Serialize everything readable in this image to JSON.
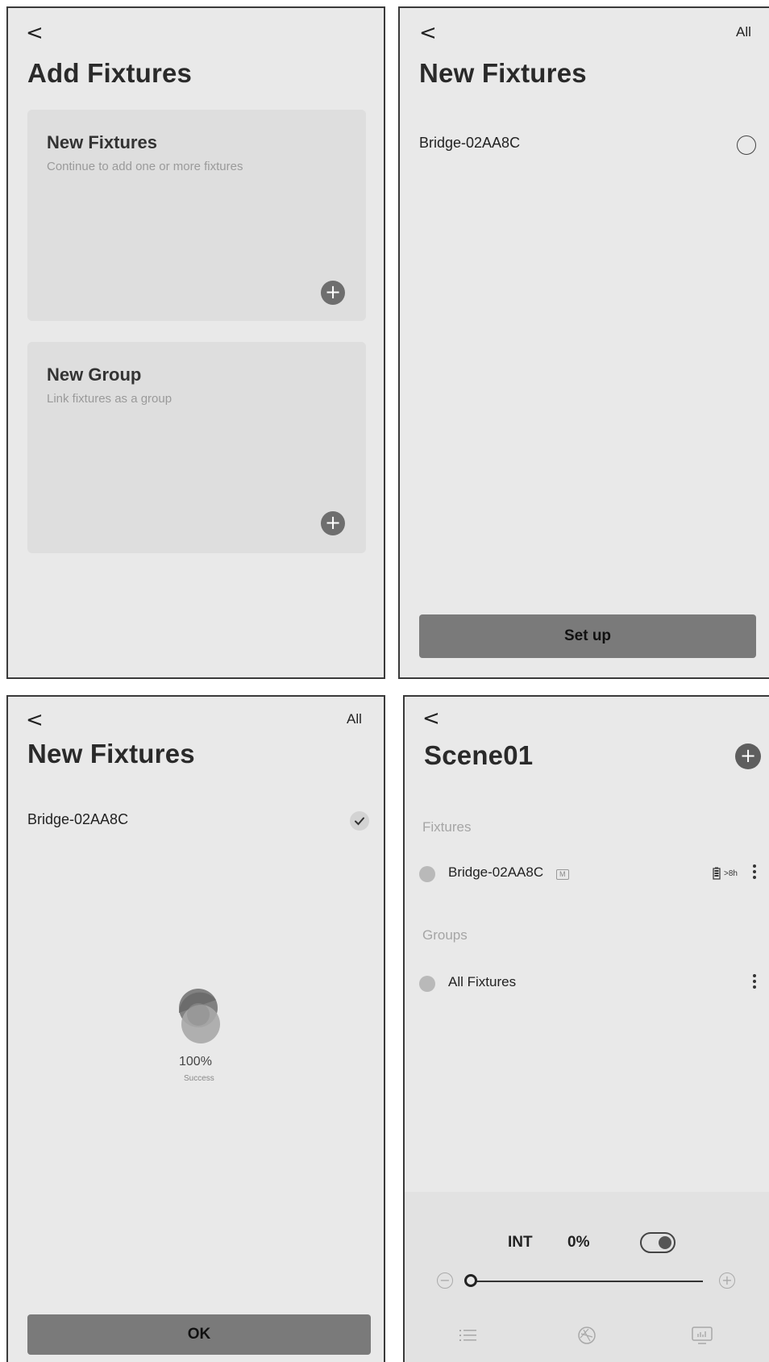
{
  "panel1": {
    "back": "<",
    "title": "Add Fixtures",
    "cards": [
      {
        "title": "New Fixtures",
        "subtitle": "Continue to add one or more fixtures",
        "action": "+"
      },
      {
        "title": "New Group",
        "subtitle": "Link fixtures as a group",
        "action": "+"
      }
    ]
  },
  "panel2": {
    "back": "<",
    "filter": "All",
    "title": "New Fixtures",
    "items": [
      {
        "label": "Bridge-02AA8C",
        "selected": false
      }
    ],
    "button": "Set up"
  },
  "panel3": {
    "back": "<",
    "filter": "All",
    "title": "New Fixtures",
    "items": [
      {
        "label": "Bridge-02AA8C",
        "selected": true
      }
    ],
    "progress": {
      "value": "100%",
      "status": "Success",
      "fraction": 1.0
    },
    "button": "OK"
  },
  "panel4": {
    "back": "<",
    "title": "Scene01",
    "add": "+",
    "fixtures_label": "Fixtures",
    "fixtures": [
      {
        "label": "Bridge-02AA8C",
        "badge": "M",
        "battery": ">8h"
      }
    ],
    "groups_label": "Groups",
    "groups": [
      {
        "label": "All Fixtures"
      }
    ],
    "control": {
      "mode": "INT",
      "value": "0%",
      "toggle_on": true,
      "slider_fraction": 0.0,
      "minus": "−",
      "plus": "+"
    },
    "nav": [
      "list-icon",
      "palette-icon",
      "monitor-icon"
    ]
  }
}
